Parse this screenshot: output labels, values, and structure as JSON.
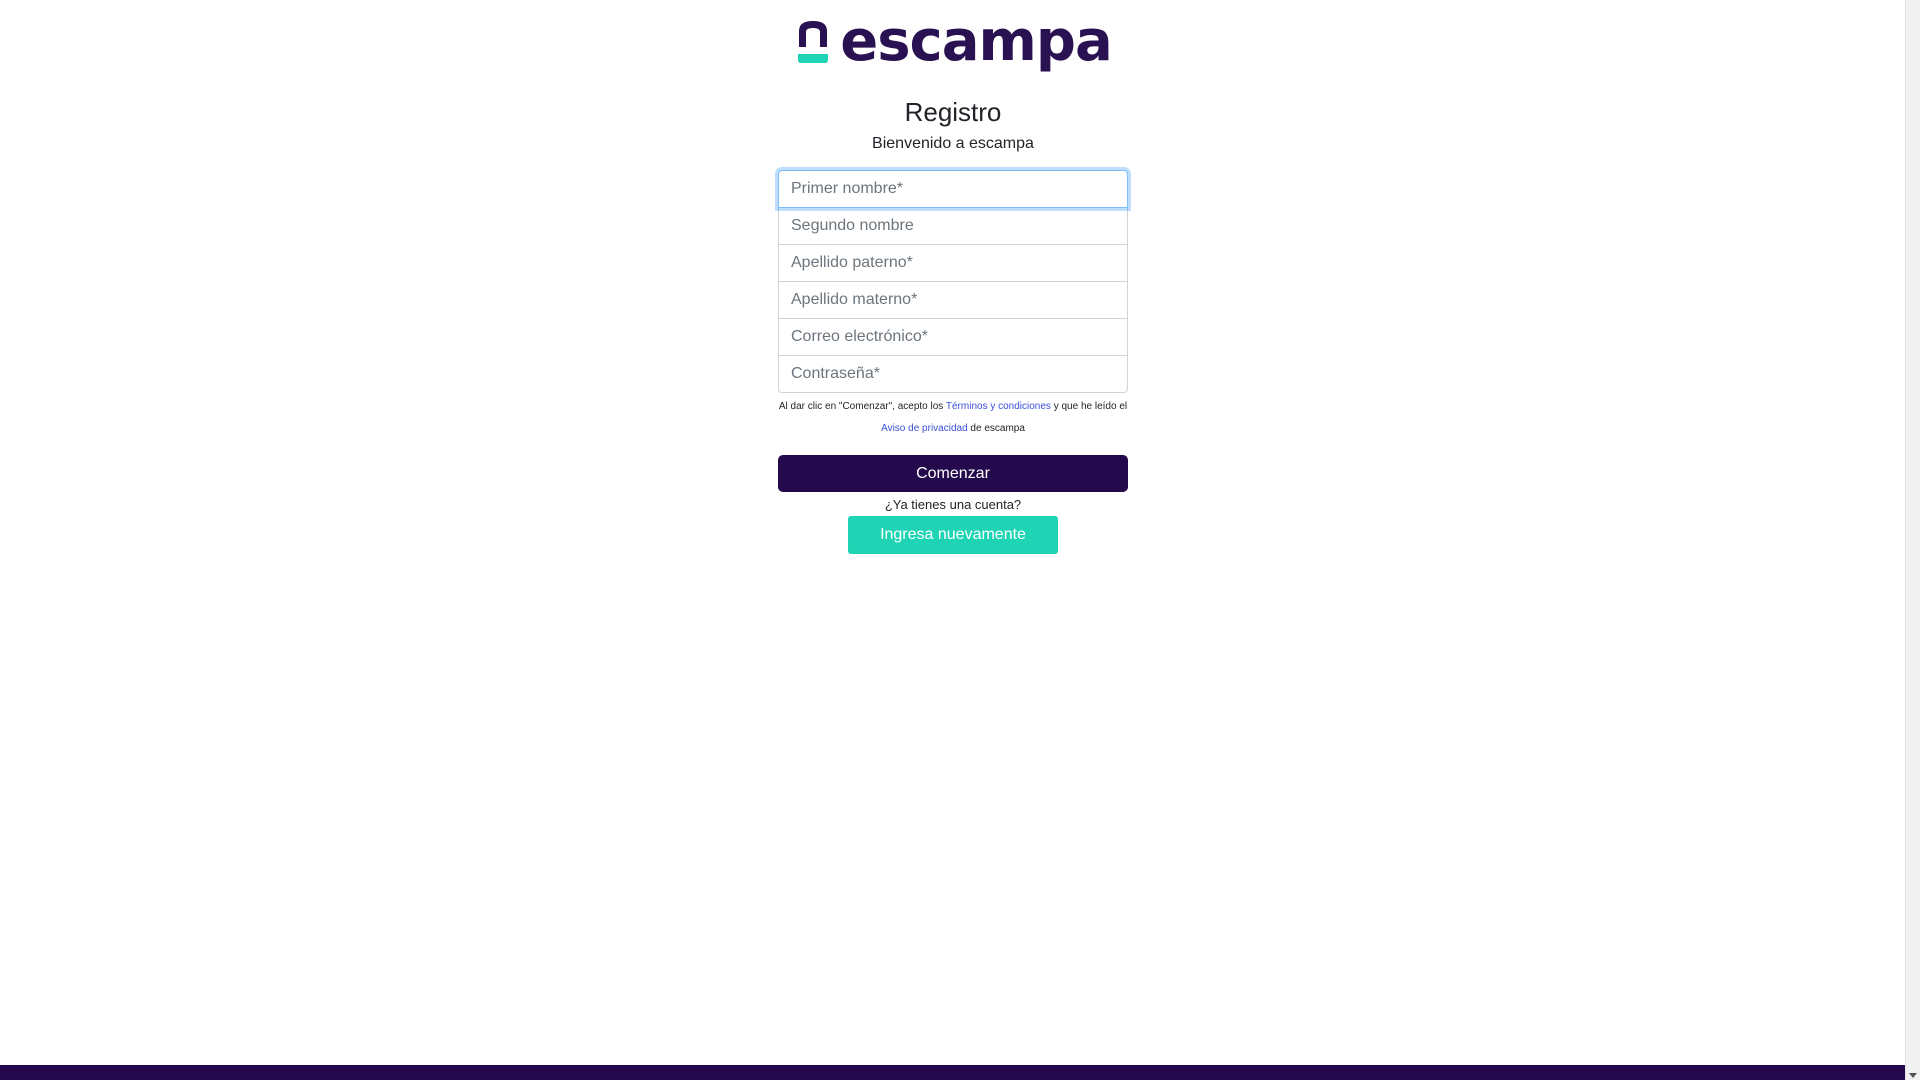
{
  "brand": {
    "logo_text": "escampa",
    "primary_color": "#24094c",
    "accent_color": "#1ed4b4",
    "link_color": "#3a4fd8"
  },
  "header": {
    "title": "Registro",
    "subtitle": "Bienvenido a escampa"
  },
  "form": {
    "fields": [
      {
        "placeholder": "Primer nombre*",
        "value": ""
      },
      {
        "placeholder": "Segundo nombre",
        "value": ""
      },
      {
        "placeholder": "Apellido paterno*",
        "value": ""
      },
      {
        "placeholder": "Apellido materno*",
        "value": ""
      },
      {
        "placeholder": "Correo electrónico*",
        "value": ""
      },
      {
        "placeholder": "Contraseña*",
        "value": ""
      }
    ],
    "legal": {
      "text_1": "Al dar clic en \"Comenzar\", acepto los ",
      "terms_link": "Términos y condiciones",
      "text_2": " y que he leído el",
      "privacy_link": "Aviso de privacidad",
      "text_3": " de escampa"
    },
    "submit_label": "Comenzar"
  },
  "login": {
    "prompt": "¿Ya tienes una cuenta?",
    "button_label": "Ingresa nuevamente"
  }
}
